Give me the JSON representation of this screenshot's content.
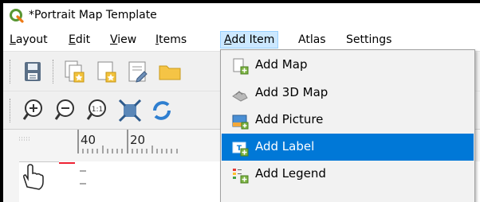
{
  "window": {
    "title": "*Portrait Map Template"
  },
  "menubar": {
    "items": [
      {
        "label": "Layout",
        "ul": "L",
        "rest": "ayout"
      },
      {
        "label": "Edit",
        "ul": "E",
        "rest": "dit"
      },
      {
        "label": "View",
        "ul": "V",
        "rest": "iew"
      },
      {
        "label": "Items",
        "ul": "I",
        "rest": "tems"
      },
      {
        "label": "Add Item",
        "ul": "A",
        "rest": "dd Item"
      },
      {
        "label": "Atlas"
      },
      {
        "label": "Settings"
      }
    ]
  },
  "ruler": {
    "labels": [
      "40",
      "20"
    ]
  },
  "dropdown": {
    "items": [
      {
        "label": "Add Map",
        "icon": "map-icon"
      },
      {
        "label": "Add 3D Map",
        "icon": "3d-map-icon"
      },
      {
        "label": "Add Picture",
        "icon": "picture-icon"
      },
      {
        "label": "Add Label",
        "icon": "label-icon",
        "selected": true
      },
      {
        "label": "Add Legend",
        "icon": "legend-icon"
      }
    ]
  },
  "colors": {
    "accent": "#0078d7",
    "menu_active": "#cce8ff",
    "qgis_green": "#589632"
  }
}
